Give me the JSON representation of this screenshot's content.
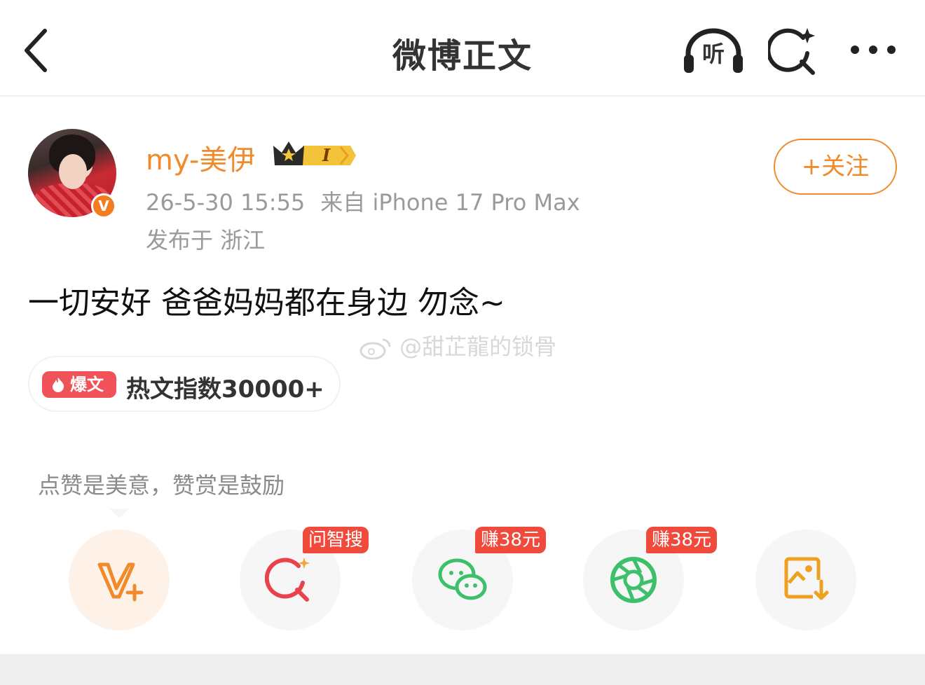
{
  "nav": {
    "title": "微博正文",
    "listen_label": "听"
  },
  "post": {
    "author": {
      "name": "my-美伊",
      "verified_badge": "V",
      "member_level": "I"
    },
    "time": "26-5-30 15:55",
    "source": "来自 iPhone 17 Pro Max",
    "location": "发布于 浙江",
    "follow_label": "+关注",
    "text": "一切安好 爸爸妈妈都在身边 勿念~",
    "watermark": "@甜芷龍的锁骨",
    "hot": {
      "tag": "爆文",
      "text": "热文指数30000+"
    }
  },
  "reward": {
    "hint": "点赞是美意，赞赏是鼓励"
  },
  "actions": [
    {
      "name": "vplus",
      "icon": "v-plus-icon",
      "badge": ""
    },
    {
      "name": "zhisou",
      "icon": "smart-search-icon",
      "badge": "问智搜"
    },
    {
      "name": "wechat",
      "icon": "wechat-icon",
      "badge": "赚38元"
    },
    {
      "name": "moments",
      "icon": "moments-icon",
      "badge": "赚38元"
    },
    {
      "name": "save-image",
      "icon": "save-image-icon",
      "badge": ""
    }
  ],
  "colors": {
    "accent": "#f08a2a",
    "hot_tag": "#f0525a",
    "badge": "#f04a3c",
    "wechat_green": "#3cc06a"
  }
}
